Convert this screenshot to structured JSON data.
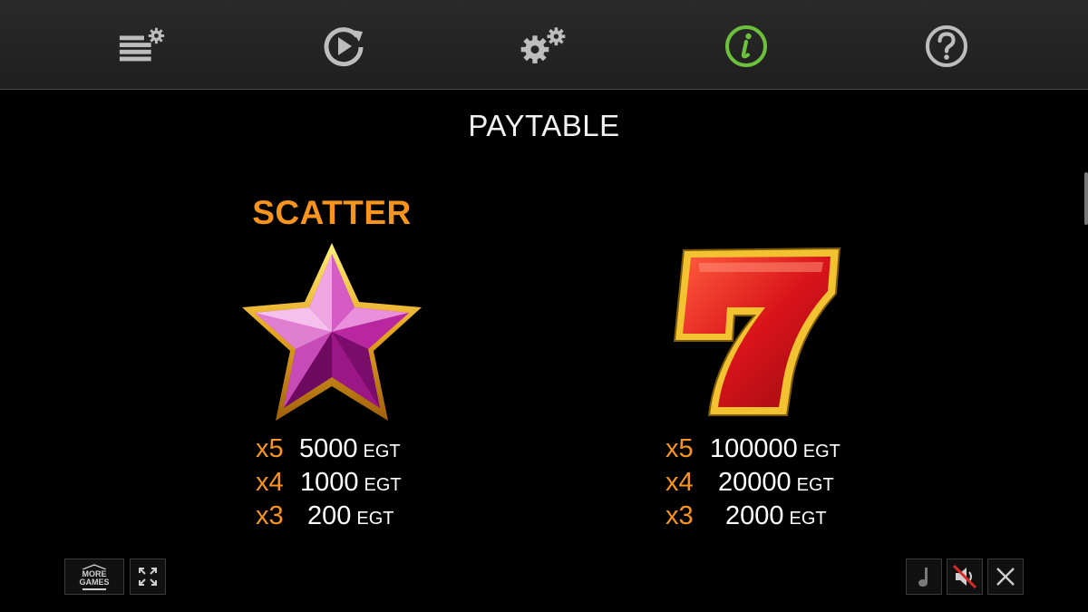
{
  "toolbar": {
    "items": [
      {
        "icon": "bet-settings-icon"
      },
      {
        "icon": "autoplay-icon"
      },
      {
        "icon": "settings-gears-icon"
      },
      {
        "icon": "info-icon",
        "active": true,
        "active_color": "#6cc03b"
      },
      {
        "icon": "help-icon"
      }
    ]
  },
  "page": {
    "title": "PAYTABLE"
  },
  "symbols": [
    {
      "name": "SCATTER",
      "icon": "pink-star-symbol",
      "payouts": [
        {
          "mult": "x5",
          "amount": "5000",
          "currency": "EGT"
        },
        {
          "mult": "x4",
          "amount": "1000",
          "currency": "EGT"
        },
        {
          "mult": "x3",
          "amount": "200",
          "currency": "EGT"
        }
      ]
    },
    {
      "name": "",
      "icon": "red-seven-symbol",
      "payouts": [
        {
          "mult": "x5",
          "amount": "100000",
          "currency": "EGT"
        },
        {
          "mult": "x4",
          "amount": "20000",
          "currency": "EGT"
        },
        {
          "mult": "x3",
          "amount": "2000",
          "currency": "EGT"
        }
      ]
    }
  ],
  "bottom": {
    "more_games_line1": "MORE",
    "more_games_line2": "GAMES",
    "fullscreen_icon": "fullscreen-icon",
    "music_icon": "music-note-icon",
    "sound_icon": "sound-muted-icon",
    "close_icon": "close-icon"
  },
  "colors": {
    "accent_orange": "#f7941d",
    "active_green": "#6cc03b",
    "icon_gray": "#bdbdbd"
  }
}
